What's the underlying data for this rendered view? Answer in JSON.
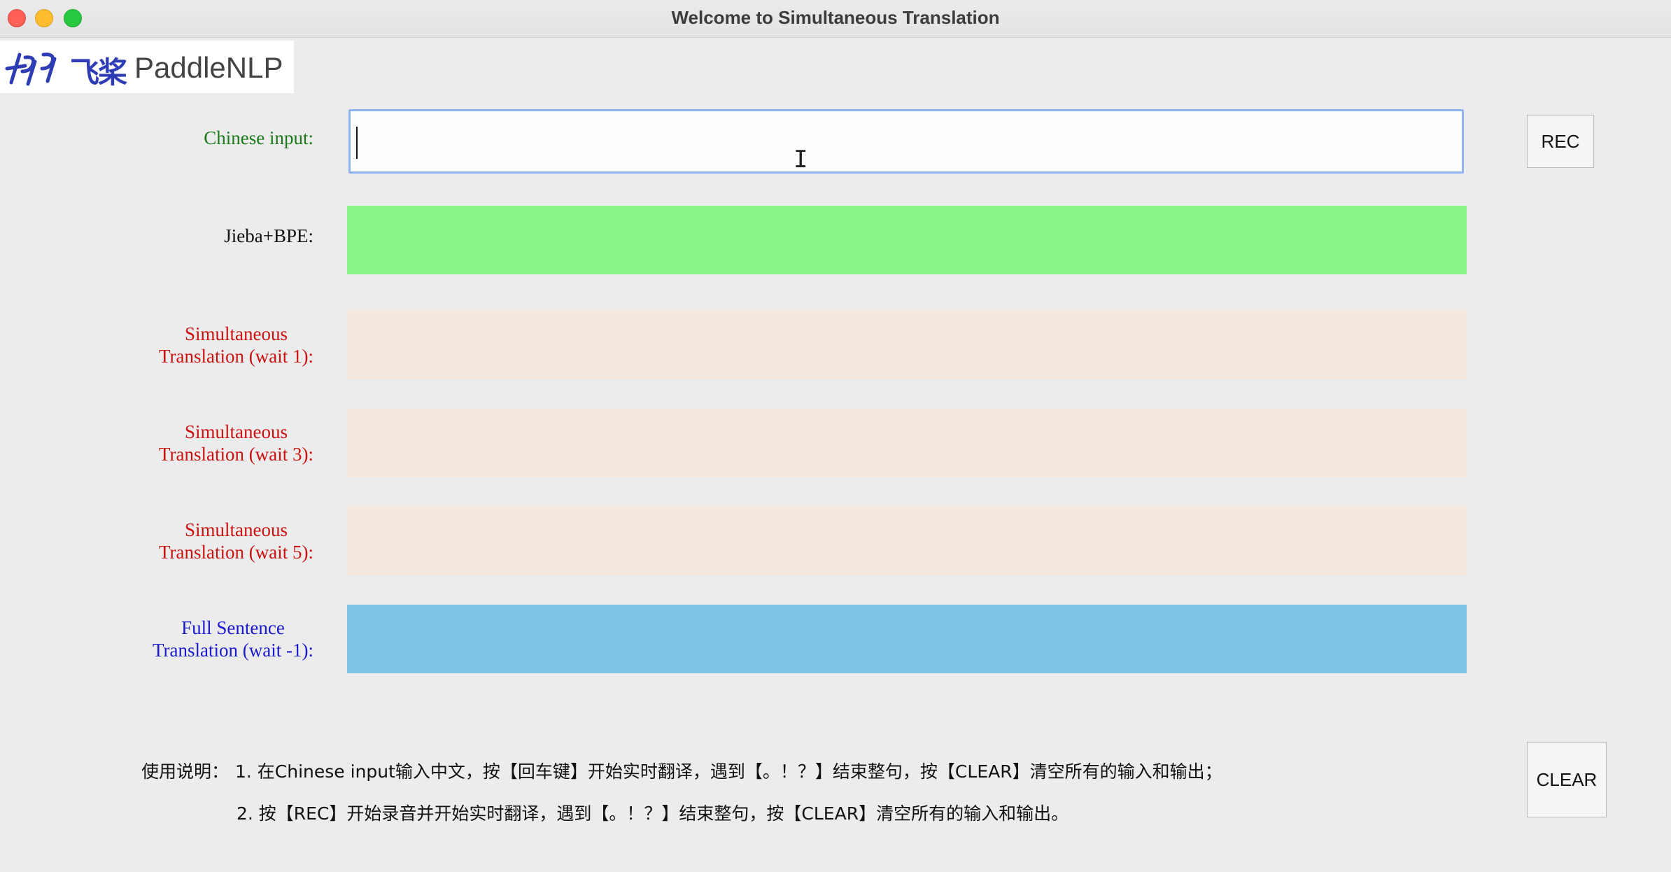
{
  "window": {
    "title": "Welcome to Simultaneous Translation"
  },
  "logo": {
    "cn_text": "飞桨",
    "en_text": "PaddleNLP"
  },
  "rows": {
    "input": {
      "label": "Chinese input:",
      "value": "",
      "color": "#1a7a1a"
    },
    "jieba": {
      "label": "Jieba+BPE:",
      "value": "",
      "color": "#111111",
      "fill": "#8af58a"
    },
    "wait1": {
      "label_line1": "Simultaneous",
      "label_line2": "Translation (wait 1):",
      "value": "",
      "color": "#cc1111",
      "fill": "#f5e9df"
    },
    "wait3": {
      "label_line1": "Simultaneous",
      "label_line2": "Translation (wait 3):",
      "value": "",
      "color": "#cc1111",
      "fill": "#f5e9df"
    },
    "wait5": {
      "label_line1": "Simultaneous",
      "label_line2": "Translation (wait 5):",
      "value": "",
      "color": "#cc1111",
      "fill": "#f5e9df"
    },
    "full": {
      "label_line1": "Full Sentence",
      "label_line2": "Translation (wait -1):",
      "value": "",
      "color": "#1a1acc",
      "fill": "#7ec4e6"
    }
  },
  "buttons": {
    "rec": "REC",
    "clear": "CLEAR"
  },
  "help": {
    "prefix": "使用说明：",
    "line1": "1. 在Chinese input输入中文，按【回车键】开始实时翻译，遇到【。！？】结束整句，按【CLEAR】清空所有的输入和输出；",
    "line2": "2. 按【REC】开始录音并开始实时翻译，遇到【。！？】结束整句，按【CLEAR】清空所有的输入和输出。"
  }
}
